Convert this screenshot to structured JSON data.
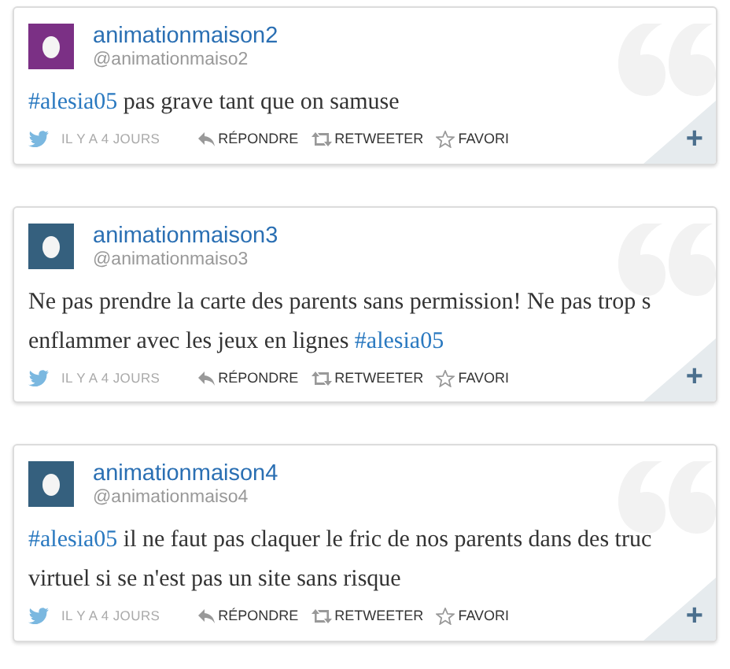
{
  "tweets": [
    {
      "name": "animationmaison2",
      "handle": "@animationmaiso2",
      "color": "#7b3085",
      "text": [
        {
          "kind": "hashtag",
          "text": "#alesia05"
        },
        {
          "kind": "plain",
          "text": " pas grave tant que on samuse"
        }
      ],
      "time": "IL Y A 4 JOURS",
      "actions": [
        "RÉPONDRE",
        "RETWEETER",
        "FAVORI"
      ],
      "expand": "+"
    },
    {
      "name": "animationmaison3",
      "handle": "@animationmaiso3",
      "color": "#35607e",
      "text": [
        {
          "kind": "plain",
          "text": "Ne pas prendre la carte des parents sans permission! Ne pas trop s enflammer avec les jeux en lignes "
        },
        {
          "kind": "hashtag",
          "text": "#alesia05"
        }
      ],
      "time": "IL Y A 4 JOURS",
      "actions": [
        "RÉPONDRE",
        "RETWEETER",
        "FAVORI"
      ],
      "expand": "+"
    },
    {
      "name": "animationmaison4",
      "handle": "@animationmaiso4",
      "color": "#35607e",
      "text": [
        {
          "kind": "hashtag",
          "text": "#alesia05"
        },
        {
          "kind": "plain",
          "text": " il ne faut pas claquer le fric de nos parents dans des truc virtuel si se n'est pas un site sans risque"
        }
      ],
      "time": "IL Y A 4 JOURS",
      "actions": [
        "RÉPONDRE",
        "RETWEETER",
        "FAVORI"
      ],
      "expand": "+"
    }
  ]
}
